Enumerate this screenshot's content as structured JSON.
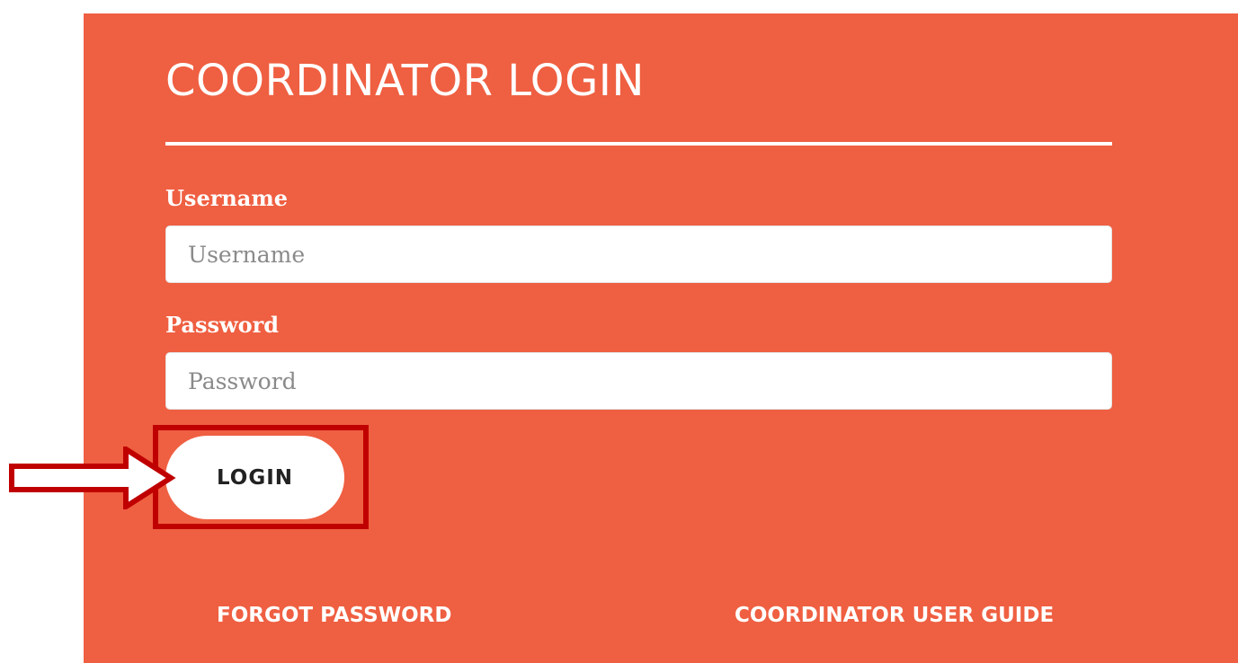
{
  "title": "COORDINATOR LOGIN",
  "username": {
    "label": "Username",
    "placeholder": "Username",
    "value": ""
  },
  "password": {
    "label": "Password",
    "placeholder": "Password",
    "value": ""
  },
  "login_button": "LOGIN",
  "links": {
    "forgot_password": "FORGOT PASSWORD",
    "user_guide": "COORDINATOR USER GUIDE"
  },
  "colors": {
    "panel": "#ef5f41",
    "highlight": "#c00000",
    "text": "#ffffff"
  },
  "annotation": {
    "arrow": "right-arrow-icon",
    "box": "highlight-box"
  }
}
